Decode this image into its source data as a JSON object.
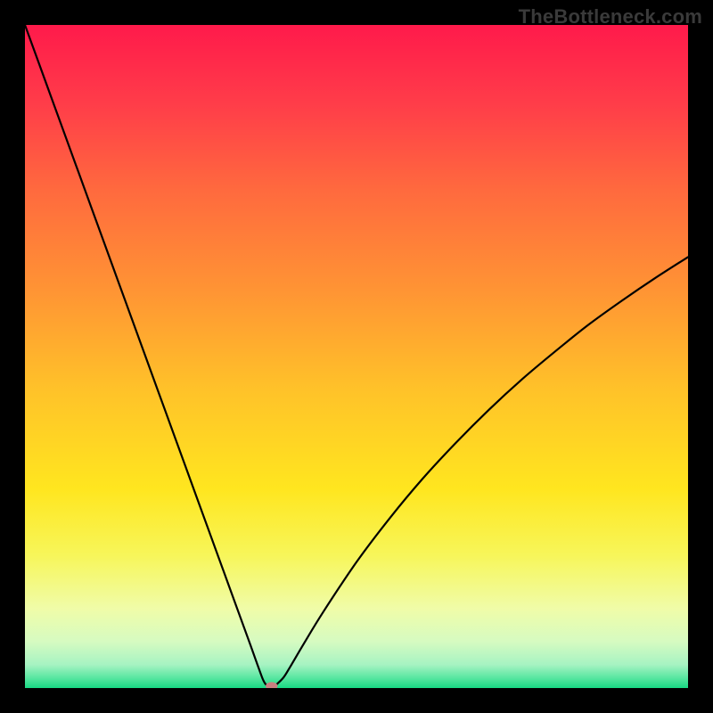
{
  "watermark": "TheBottleneck.com",
  "chart_data": {
    "type": "line",
    "title": "",
    "xlabel": "",
    "ylabel": "",
    "xlim": [
      0,
      100
    ],
    "ylim": [
      0,
      100
    ],
    "grid": false,
    "legend": false,
    "curve": {
      "name": "bottleneck-curve",
      "color": "#000000",
      "width": 2.2,
      "x": [
        0,
        2,
        4,
        6,
        8,
        10,
        12,
        14,
        16,
        18,
        20,
        22,
        24,
        26,
        28,
        30,
        32,
        34,
        35,
        35.8,
        36.2,
        36.6,
        37,
        37.5,
        38,
        39,
        40,
        42,
        45,
        50,
        55,
        60,
        65,
        70,
        75,
        80,
        85,
        90,
        95,
        100
      ],
      "y": [
        100,
        94.5,
        89,
        83.5,
        78,
        72.5,
        67,
        61.5,
        56,
        50.5,
        45,
        39.5,
        34,
        28.5,
        23,
        17.5,
        12,
        6.5,
        3.7,
        1.5,
        0.7,
        0.3,
        0.15,
        0.2,
        0.6,
        1.6,
        3.2,
        6.6,
        11.5,
        19,
        25.6,
        31.6,
        37,
        42,
        46.6,
        50.8,
        54.8,
        58.4,
        61.8,
        65
      ]
    },
    "marker": {
      "x": 37.2,
      "y": 0.3,
      "rx": 0.9,
      "ry": 0.6,
      "color": "#c97f80"
    },
    "background": {
      "type": "vertical-gradient",
      "stops": [
        {
          "offset": 0.0,
          "color": "#ff1a4b"
        },
        {
          "offset": 0.12,
          "color": "#ff3d49"
        },
        {
          "offset": 0.25,
          "color": "#ff6a3e"
        },
        {
          "offset": 0.4,
          "color": "#ff9434"
        },
        {
          "offset": 0.55,
          "color": "#ffc229"
        },
        {
          "offset": 0.7,
          "color": "#ffe61f"
        },
        {
          "offset": 0.8,
          "color": "#f7f65a"
        },
        {
          "offset": 0.88,
          "color": "#f0fca8"
        },
        {
          "offset": 0.93,
          "color": "#d6fbc1"
        },
        {
          "offset": 0.965,
          "color": "#a6f3c2"
        },
        {
          "offset": 0.985,
          "color": "#57e6a0"
        },
        {
          "offset": 1.0,
          "color": "#18d983"
        }
      ]
    }
  }
}
